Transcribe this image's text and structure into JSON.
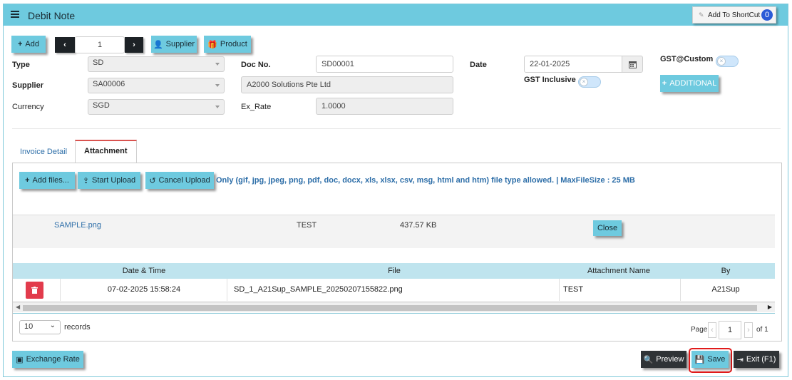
{
  "window": {
    "title": "Debit Note",
    "shortcut_label": "Add To ShortCut",
    "shortcut_count": "0"
  },
  "toolbar": {
    "add_label": "Add",
    "page_value": "1",
    "supplier_label": "Supplier",
    "product_label": "Product"
  },
  "form": {
    "type_label": "Type",
    "type_value": "SD",
    "supplier_label": "Supplier",
    "supplier_value": "SA00006",
    "supplier_name": "A2000 Solutions Pte Ltd",
    "currency_label": "Currency",
    "currency_value": "SGD",
    "docno_label": "Doc No.",
    "docno_value": "SD00001",
    "exrate_label": "Ex_Rate",
    "exrate_value": "1.0000",
    "date_label": "Date",
    "date_value": "22-01-2025",
    "gst_custom_label": "GST@Custom",
    "gst_inclusive_label": "GST Inclusive",
    "additional_label": "ADDITIONAL"
  },
  "tabs": [
    {
      "label": "Invoice Detail"
    },
    {
      "label": "Attachment"
    }
  ],
  "attachment": {
    "add_files_label": "Add files...",
    "start_upload_label": "Start Upload",
    "cancel_upload_label": "Cancel Upload",
    "note": "Only (gif, jpg, jpeg, png, pdf, doc, docx, xls, xlsx, csv, msg, html and htm) file type allowed. | MaxFileSize : 25 MB",
    "queued_file": {
      "name": "SAMPLE.png",
      "title": "TEST",
      "size": "437.57 KB",
      "close_label": "Close"
    }
  },
  "table": {
    "columns": [
      "Date & Time",
      "File",
      "Attachment Name",
      "By"
    ],
    "rows": [
      {
        "datetime": "07-02-2025 15:58:24",
        "file": "SD_1_A21Sup_SAMPLE_20250207155822.png",
        "name": "TEST",
        "by": "A21Sup"
      }
    ]
  },
  "pager": {
    "records_value": "10",
    "records_label": "records",
    "page_label": "Page",
    "page_value": "1",
    "of_label": "of 1"
  },
  "footer": {
    "exchange_rate_label": "Exchange Rate",
    "preview_label": "Preview",
    "save_label": "Save",
    "exit_label": "Exit (F1)"
  }
}
